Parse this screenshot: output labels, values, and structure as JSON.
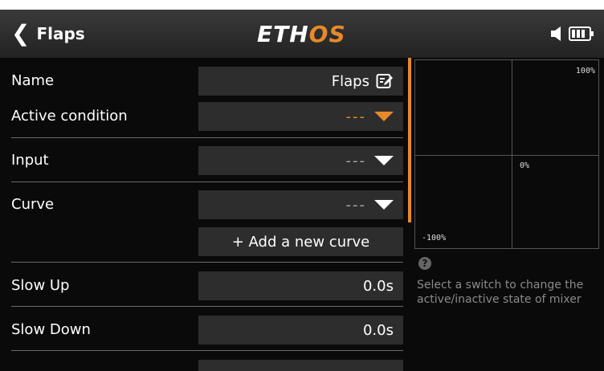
{
  "header": {
    "back_icon": "chevron-left",
    "title": "Flaps",
    "logo_prefix": "ETH",
    "logo_suffix": "OS",
    "status": [
      "volume-icon",
      "battery-icon"
    ]
  },
  "form": {
    "name": {
      "label": "Name",
      "value": "Flaps"
    },
    "active_condition": {
      "label": "Active condition",
      "value": "---"
    },
    "input": {
      "label": "Input",
      "value": "---"
    },
    "curve": {
      "label": "Curve",
      "value": "---"
    },
    "add_curve": {
      "label": "+ Add a new curve"
    },
    "slow_up": {
      "label": "Slow Up",
      "value": "0.0s"
    },
    "slow_down": {
      "label": "Slow Down",
      "value": "0.0s"
    }
  },
  "graph": {
    "top_label": "100%",
    "center_label": "0%",
    "bottom_label": "-100%"
  },
  "help": {
    "icon": "question-icon",
    "text": "Select a switch to change the active/inactive state of mixer"
  },
  "colors": {
    "accent": "#e8892a",
    "field_bg": "#2d2d2d",
    "screen_bg": "#0a0a0a"
  }
}
